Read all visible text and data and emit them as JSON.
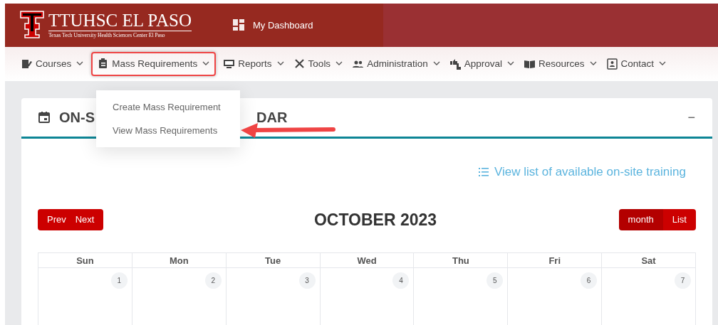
{
  "header": {
    "logo_title": "TTUHSC EL PASO",
    "logo_subtitle": "Texas Tech University Health Sciences Center El Paso",
    "dashboard_link": "My Dashboard"
  },
  "nav": [
    {
      "label": "Courses",
      "selected": false
    },
    {
      "label": "Mass Requirements",
      "selected": true
    },
    {
      "label": "Reports",
      "selected": false
    },
    {
      "label": "Tools",
      "selected": false
    },
    {
      "label": "Administration",
      "selected": false
    },
    {
      "label": "Approval",
      "selected": false
    },
    {
      "label": "Resources",
      "selected": false
    },
    {
      "label": "Contact",
      "selected": false
    }
  ],
  "dropdown": {
    "items": [
      "Create Mass Requirement",
      "View Mass Requirements"
    ]
  },
  "card": {
    "title_parts": [
      "ON-S",
      "DAR"
    ],
    "collapse": "−",
    "list_link": "View list of available on-site training",
    "calendar": {
      "nav_buttons": [
        "Prev",
        "Next"
      ],
      "month_title": "OCTOBER 2023",
      "views": [
        {
          "label": "month",
          "selected": true
        },
        {
          "label": "List",
          "selected": false
        }
      ],
      "weekdays": [
        "Sun",
        "Mon",
        "Tue",
        "Wed",
        "Thu",
        "Fri",
        "Sat"
      ],
      "days": [
        "1",
        "2",
        "3",
        "4",
        "5",
        "6",
        "7"
      ]
    }
  }
}
